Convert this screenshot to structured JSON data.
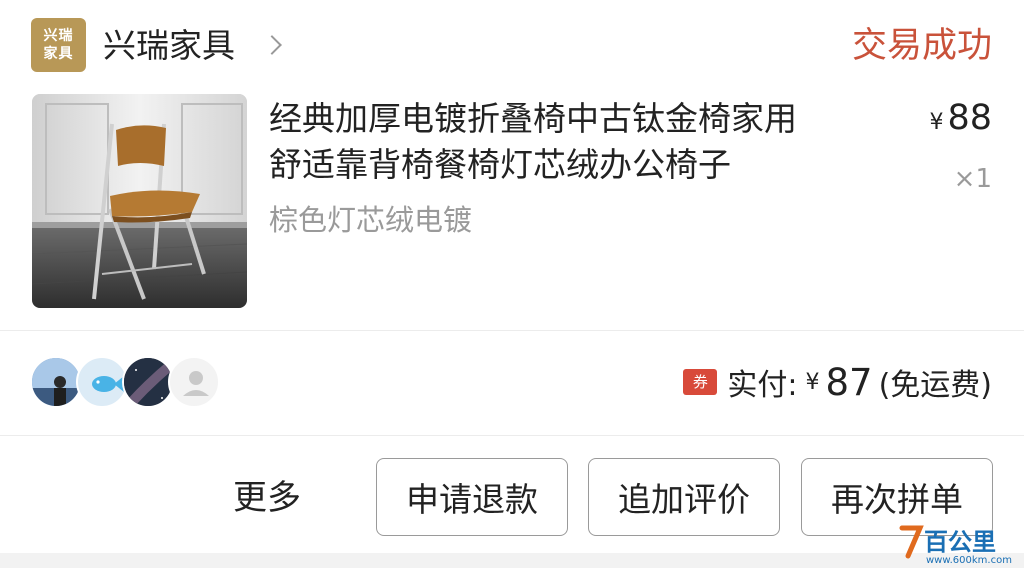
{
  "shop": {
    "logo_lines": [
      "兴瑞",
      "家具"
    ],
    "name": "兴瑞家具"
  },
  "order": {
    "status": "交易成功",
    "product": {
      "title_line1": "经典加厚电镀折叠椅中古钛金椅家用",
      "title_line2": "舒适靠背椅餐椅灯芯绒办公椅子",
      "variant": "棕色灯芯绒电镀",
      "price_symbol": "¥",
      "price": "88",
      "quantity": "×1"
    },
    "payment": {
      "coupon_label": "券",
      "paid_label": "实付:",
      "currency": "¥",
      "amount": "87",
      "note": "(免运费)"
    }
  },
  "actions": {
    "more": "更多",
    "refund": "申请退款",
    "add_review": "追加评价",
    "regroup": "再次拼单"
  },
  "watermark": {
    "brand": "百公里",
    "url": "www.600km.com"
  },
  "colors": {
    "status": "#c9523a",
    "logo_bg": "#b89857",
    "coupon_bg": "#d84a3a"
  }
}
